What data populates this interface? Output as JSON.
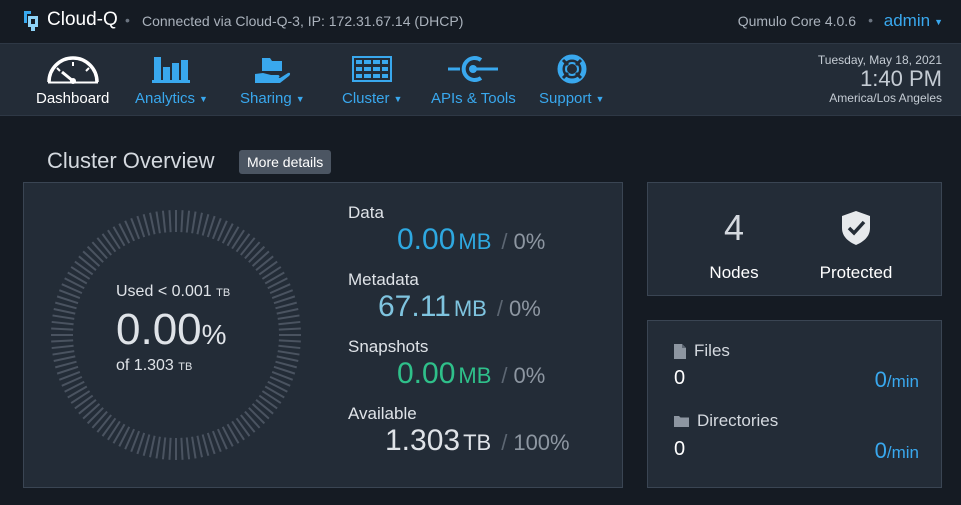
{
  "header": {
    "app_name": "Cloud-Q",
    "connection": "Connected via Cloud-Q-3, IP: 172.31.67.14 (DHCP)",
    "version": "Qumulo Core 4.0.6",
    "user": "admin"
  },
  "nav": {
    "items": [
      {
        "label": "Dashboard",
        "icon": "gauge-icon",
        "active": true,
        "dropdown": false
      },
      {
        "label": "Analytics",
        "icon": "bar-chart-icon",
        "active": false,
        "dropdown": true
      },
      {
        "label": "Sharing",
        "icon": "share-hand-icon",
        "active": false,
        "dropdown": true
      },
      {
        "label": "Cluster",
        "icon": "server-rack-icon",
        "active": false,
        "dropdown": true
      },
      {
        "label": "APIs & Tools",
        "icon": "api-icon",
        "active": false,
        "dropdown": false
      },
      {
        "label": "Support",
        "icon": "lifebuoy-icon",
        "active": false,
        "dropdown": true
      }
    ]
  },
  "clock": {
    "date": "Tuesday, May 18, 2021",
    "time": "1:40 PM",
    "timezone": "America/Los Angeles"
  },
  "overview": {
    "title": "Cluster Overview",
    "more_details": "More details"
  },
  "capacity": {
    "used_label": "Used",
    "used_value": "< 0.001",
    "used_unit": "TB",
    "percent": "0.00",
    "percent_unit": "%",
    "of_label": "of 1.303",
    "of_unit": "TB",
    "used_fraction": 0.0,
    "stats": [
      {
        "label": "Data",
        "value": "0.00",
        "unit": "MB",
        "pct": "0%",
        "color": "#2ea8e0"
      },
      {
        "label": "Metadata",
        "value": "67.11",
        "unit": "MB",
        "pct": "0%",
        "color": "#7fc4df"
      },
      {
        "label": "Snapshots",
        "value": "0.00",
        "unit": "MB",
        "pct": "0%",
        "color": "#2fc08a"
      },
      {
        "label": "Available",
        "value": "1.303",
        "unit": "TB",
        "pct": "100%",
        "color": "#dfe3e8"
      }
    ]
  },
  "nodes": {
    "count": "4",
    "count_label": "Nodes",
    "protection_label": "Protected",
    "protection_icon": "shield-check-icon"
  },
  "filesystem": {
    "files_label": "Files",
    "files_count": "0",
    "files_rate": "0",
    "files_rate_unit": "/min",
    "dirs_label": "Directories",
    "dirs_count": "0",
    "dirs_rate": "0",
    "dirs_rate_unit": "/min"
  },
  "colors": {
    "accent": "#39a8ee",
    "background": "#151b23",
    "panel": "#232c37",
    "gauge_ticks": "#4a5360"
  }
}
